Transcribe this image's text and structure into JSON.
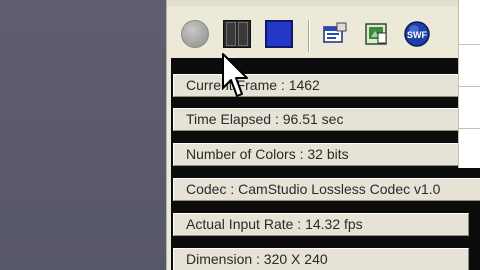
{
  "toolbar": {
    "buttons": [
      {
        "name": "record",
        "icon": "record-icon"
      },
      {
        "name": "pause",
        "icon": "pause-icon"
      },
      {
        "name": "stop",
        "icon": "stop-icon"
      },
      {
        "name": "options",
        "icon": "options-icon"
      },
      {
        "name": "annotation",
        "icon": "annotation-icon"
      },
      {
        "name": "swf",
        "icon": "swf-icon",
        "label": "SWF"
      }
    ]
  },
  "stats": {
    "current_frame": "Current Frame : 1462",
    "time_elapsed": "Time Elapsed : 96.51 sec",
    "number_of_colors": "Number of Colors : 32 bits",
    "codec": "Codec : CamStudio Lossless Codec v1.0",
    "actual_input_rate": "Actual Input Rate : 14.32 fps",
    "dimension": "Dimension : 320 X 240"
  },
  "colors": {
    "window_bg": "#ece9d8",
    "panel_bg": "#0c0c0c",
    "stop_blue": "#2438c8",
    "desktop": "#5c5c6c"
  }
}
